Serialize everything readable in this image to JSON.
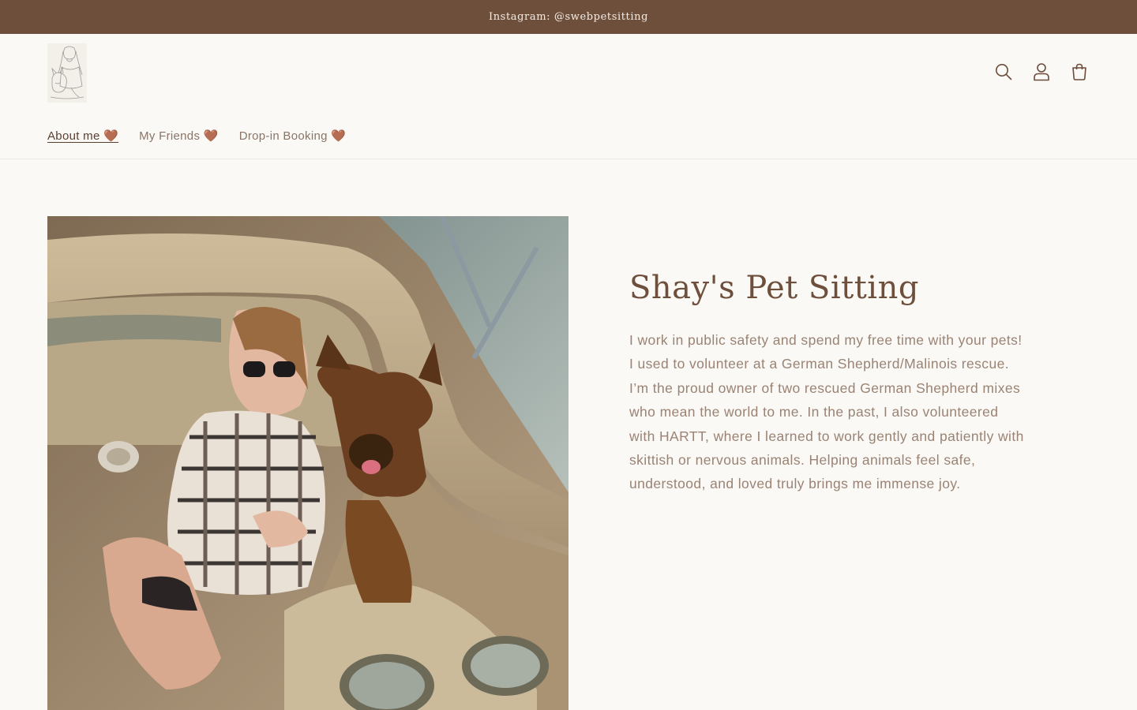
{
  "announcement": {
    "text": "Instagram: @swebpetsitting"
  },
  "header": {
    "logo_icon": "woman-with-dog-sketch-logo",
    "icons": [
      "search-icon",
      "account-icon",
      "cart-icon"
    ]
  },
  "nav": {
    "items": [
      {
        "label": "About me 🤎",
        "active": true
      },
      {
        "label": "My Friends 🤎",
        "active": false
      },
      {
        "label": "Drop-in Booking 🤎",
        "active": false
      }
    ]
  },
  "main": {
    "image_icon": "woman-with-german-shepherd-on-boat-photo",
    "title": "Shay's Pet Sitting",
    "body": "I work in public safety and spend my free time with your pets! I used to volunteer at a German Shepherd/Malinois rescue. I’m the proud owner of two rescued German Shepherd mixes who mean the world to me. In the past, I also volunteered with HARTT, where I learned to work gently and patiently with skittish or nervous animals. Helping animals feel safe, understood, and loved truly brings me immense joy."
  },
  "colors": {
    "announcement_bg": "#6e4f3c",
    "page_bg": "#fbf9f5",
    "title": "#6e4f3c",
    "body_text": "#9a8374"
  }
}
